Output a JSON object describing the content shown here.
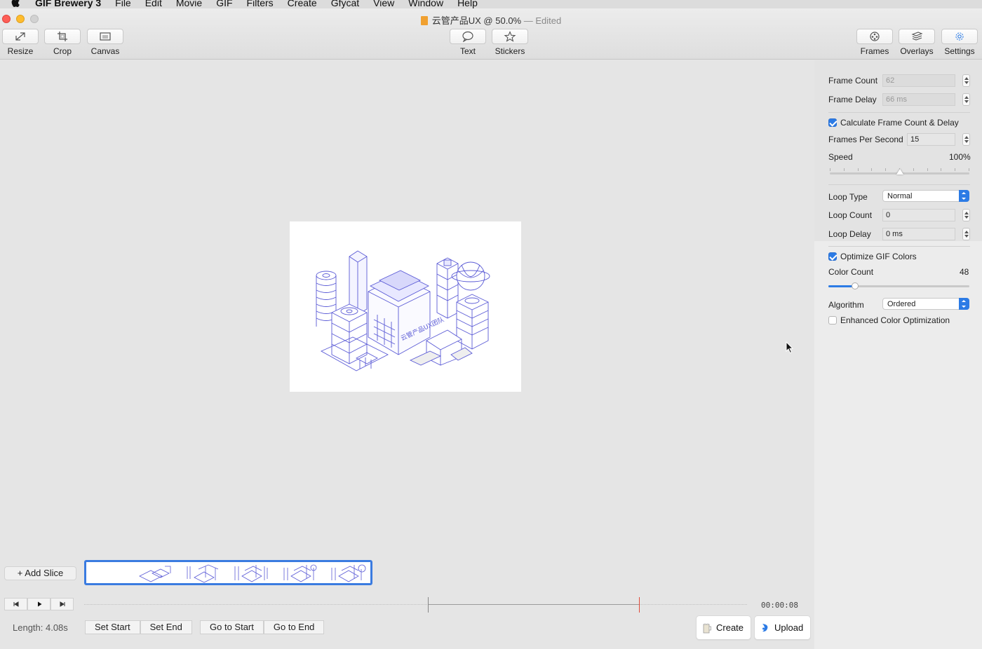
{
  "menubar": {
    "app_name": "GIF Brewery 3",
    "items": [
      "File",
      "Edit",
      "Movie",
      "GIF",
      "Filters",
      "Create",
      "Gfycat",
      "View",
      "Window",
      "Help"
    ]
  },
  "window": {
    "title": "云管产品UX @ 50.0%",
    "edited": "— Edited"
  },
  "toolbar": {
    "left": [
      {
        "label": "Resize",
        "icon": "resize-icon"
      },
      {
        "label": "Crop",
        "icon": "crop-icon"
      },
      {
        "label": "Canvas",
        "icon": "canvas-icon"
      }
    ],
    "center": [
      {
        "label": "Text",
        "icon": "speech-bubble-icon"
      },
      {
        "label": "Stickers",
        "icon": "star-icon"
      }
    ],
    "right": [
      {
        "label": "Frames",
        "icon": "film-reel-icon"
      },
      {
        "label": "Overlays",
        "icon": "layers-icon"
      },
      {
        "label": "Settings",
        "icon": "gear-icon"
      }
    ]
  },
  "preview": {
    "building_sign": "云管产品UX团队"
  },
  "settings": {
    "frame_count_label": "Frame Count",
    "frame_count_value": "62",
    "frame_delay_label": "Frame Delay",
    "frame_delay_value": "66 ms",
    "calc_label": "Calculate Frame Count & Delay",
    "calc_checked": true,
    "fps_label": "Frames Per Second",
    "fps_value": "15",
    "speed_label": "Speed",
    "speed_value": "100%",
    "speed_fraction": 0.5,
    "loop_type_label": "Loop Type",
    "loop_type_value": "Normal",
    "loop_count_label": "Loop Count",
    "loop_count_value": "0",
    "loop_delay_label": "Loop Delay",
    "loop_delay_value": "0 ms",
    "optimize_label": "Optimize GIF Colors",
    "optimize_checked": true,
    "color_count_label": "Color Count",
    "color_count_value": "48",
    "color_count_fraction": 0.19,
    "algorithm_label": "Algorithm",
    "algorithm_value": "Ordered",
    "enhanced_label": "Enhanced Color Optimization",
    "enhanced_checked": false
  },
  "timeline": {
    "add_slice_label": "+ Add Slice",
    "timecode": "00:00:08",
    "length": "Length: 4.08s",
    "set_start": "Set Start",
    "set_end": "Set End",
    "go_to_start": "Go to Start",
    "go_to_end": "Go to End",
    "create_label": "Create",
    "upload_label": "Upload"
  },
  "colors": {
    "accent": "#2c7be5",
    "end_marker": "#e04a3a",
    "illustration": "#5b5bd6"
  }
}
